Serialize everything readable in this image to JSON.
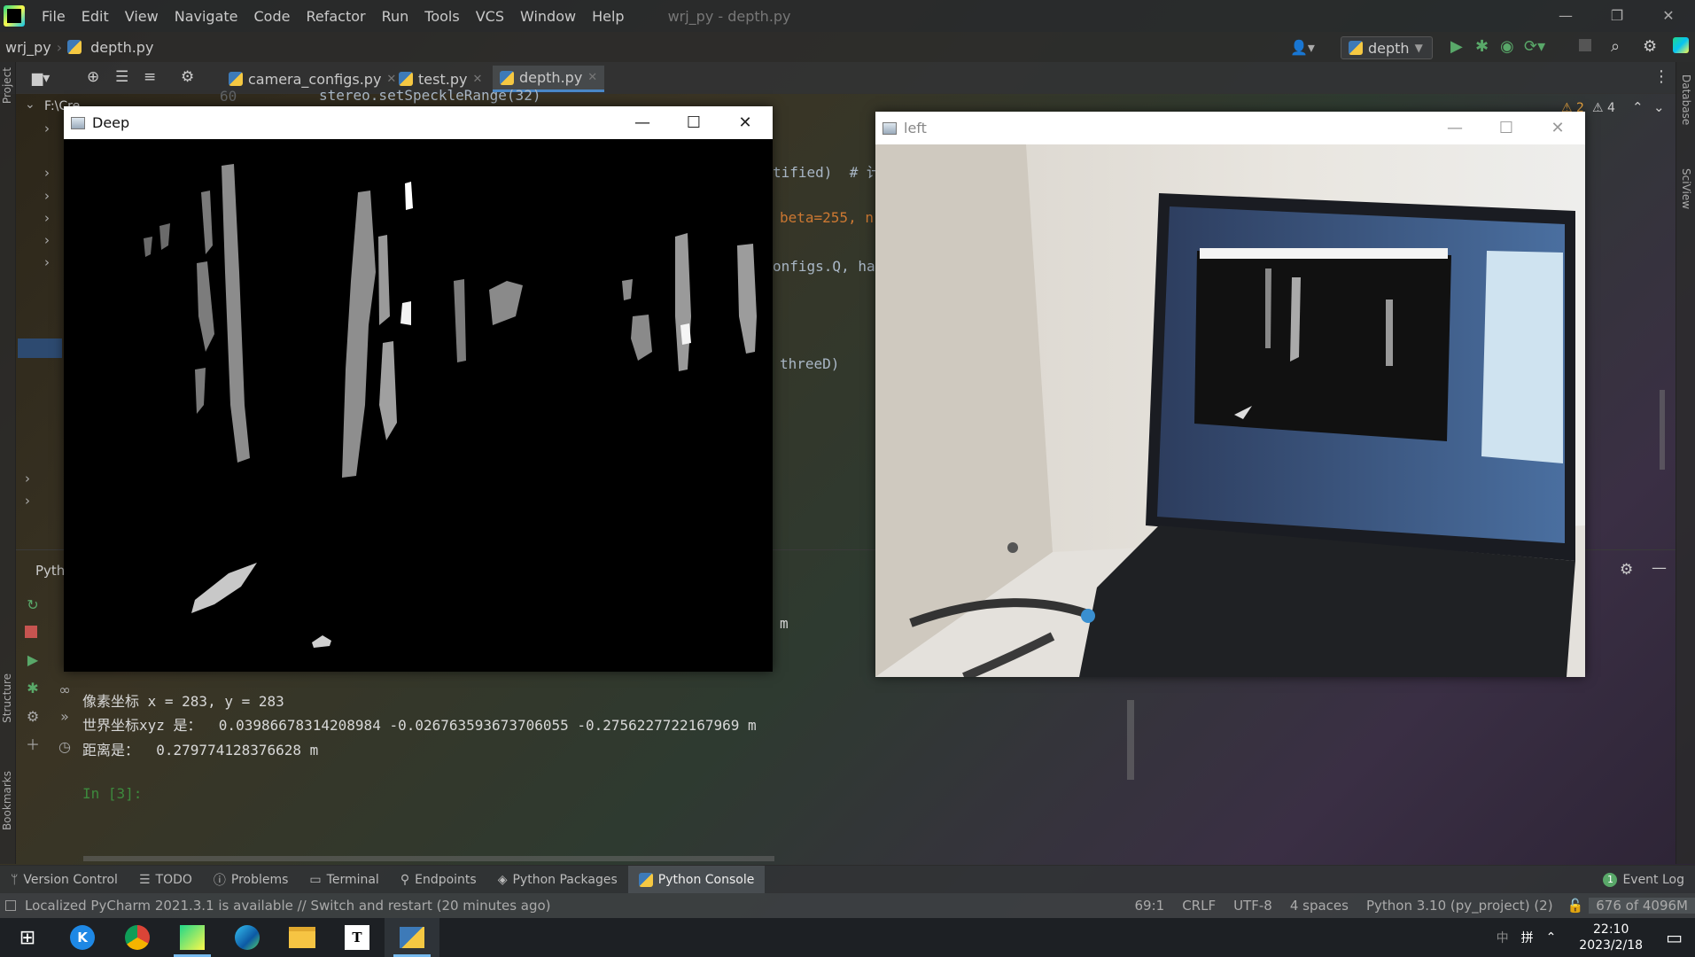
{
  "menubar": {
    "items": [
      "File",
      "Edit",
      "View",
      "Navigate",
      "Code",
      "Refactor",
      "Run",
      "Tools",
      "VCS",
      "Window",
      "Help"
    ],
    "window_title": "wrj_py - depth.py"
  },
  "navbar": {
    "project": "wrj_py",
    "file": "depth.py",
    "run_config": "depth"
  },
  "tabs": [
    {
      "label": "camera_configs.py"
    },
    {
      "label": "test.py"
    },
    {
      "label": "depth.py"
    }
  ],
  "left_stripe": {
    "project": "Project",
    "structure": "Structure",
    "bookmarks": "Bookmarks"
  },
  "right_stripe": {
    "database": "Database",
    "sciview": "SciView"
  },
  "inspections": {
    "warnings": "2",
    "weak_warnings": "4"
  },
  "tree": {
    "root": "F:\\CreatCar\\wrt_data)"
  },
  "editor": {
    "line_number": "60",
    "line_60": "stereo.setSpeckleRange(32)",
    "frag1": "tified)  # 计",
    "frag2": "beta=255, n",
    "frag3": "onfigs.Q, ha",
    "frag4": "threeD)"
  },
  "console": {
    "panel_label": "Pyth",
    "frag_m": "m",
    "lines": [
      "像素坐标 x = 283, y = 283",
      "世界坐标xyz 是：  0.03986678314208984 -0.026763593673706055 -0.2756227722167969 m",
      "距离是：  0.279774128376628 m"
    ],
    "prompt": "In [3]:"
  },
  "window_deep": {
    "title": "Deep"
  },
  "window_left": {
    "title": "left"
  },
  "toolwindows": [
    "Version Control",
    "TODO",
    "Problems",
    "Terminal",
    "Endpoints",
    "Python Packages",
    "Python Console"
  ],
  "event_log": {
    "count": "1",
    "label": "Event Log"
  },
  "status": {
    "message": "Localized PyCharm 2021.3.1 is available // Switch and restart (20 minutes ago)",
    "position": "69:1",
    "line_sep": "CRLF",
    "encoding": "UTF-8",
    "indent": "4 spaces",
    "interpreter": "Python 3.10 (py_project) (2)",
    "memory": "676 of 4096M"
  },
  "taskbar": {
    "time": "22:10",
    "date": "2023/2/18",
    "ime": "拼",
    "ime_lang": "中"
  },
  "colors": {
    "accent": "#4a88c7",
    "run_green": "#59a869",
    "stop_red": "#c75450"
  }
}
